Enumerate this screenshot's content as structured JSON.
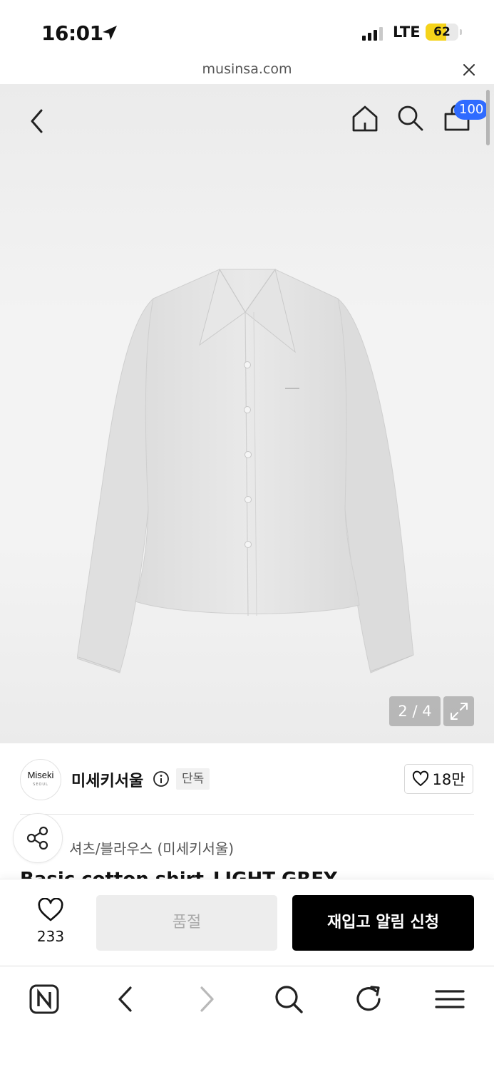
{
  "status_bar": {
    "time": "16:01",
    "network": "LTE",
    "battery": "62",
    "battery_level": 0.62,
    "battery_color": "#f5d31a"
  },
  "browser": {
    "url": "musinsa.com"
  },
  "header": {
    "cart_count": "100",
    "badge_color": "#2f6bff"
  },
  "gallery": {
    "counter": "2 / 4",
    "current": 2,
    "total": 4
  },
  "brand": {
    "logo_text": "Miseki",
    "logo_subtext": "SEOUL",
    "name": "미세키서울",
    "tag": "단독",
    "likes": "18만"
  },
  "product": {
    "category": "셔츠/블라우스 (미세키서울)",
    "title": "Basic cotton shirt_LIGHT GREY"
  },
  "purchase_bar": {
    "like_count": "233",
    "sold_out_label": "품절",
    "restock_label": "재입고 알림 신청"
  },
  "icons": [
    "location-arrow-icon",
    "signal-icon",
    "battery-icon",
    "close-icon",
    "back-icon",
    "home-icon",
    "search-icon",
    "shopping-bag-icon",
    "expand-icon",
    "info-icon",
    "heart-icon",
    "share-icon",
    "naver-icon",
    "forward-icon",
    "reload-icon",
    "menu-icon"
  ]
}
